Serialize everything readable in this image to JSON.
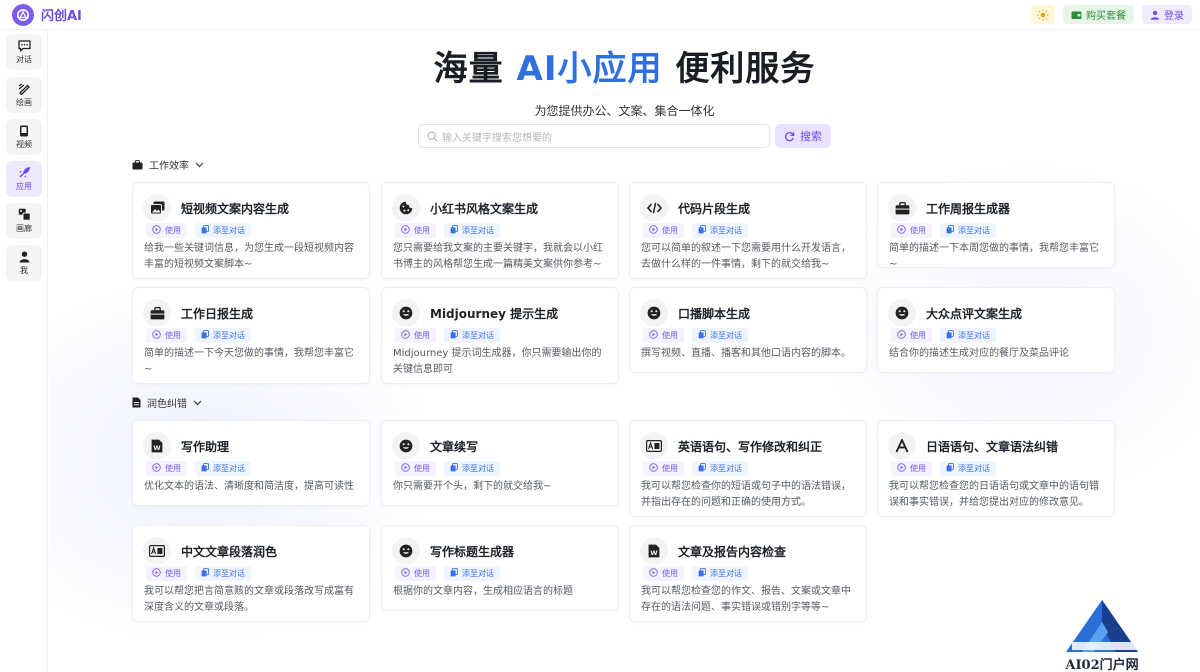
{
  "app": {
    "name": "闪创AI"
  },
  "topbar": {
    "buy_label": "购买套餐",
    "login_label": "登录"
  },
  "sidebar": {
    "items": [
      {
        "label": "对话",
        "icon": "chat-icon"
      },
      {
        "label": "绘画",
        "icon": "brush-icon"
      },
      {
        "label": "视频",
        "icon": "video-icon"
      },
      {
        "label": "应用",
        "icon": "rocket-icon",
        "active": true
      },
      {
        "label": "画廊",
        "icon": "gallery-icon"
      },
      {
        "label": "我",
        "icon": "user-icon"
      }
    ]
  },
  "hero": {
    "prefix": "海量 ",
    "highlight": "AI小应用",
    "suffix": " 便利服务",
    "subtitle": "为您提供办公、文案、集合一体化"
  },
  "search": {
    "placeholder": "输入关键字搜索您想要的",
    "button_label": "搜索"
  },
  "common": {
    "use_label": "使用",
    "add_label": "添至对话"
  },
  "sections": [
    {
      "title": "工作效率",
      "icon": "briefcase-icon",
      "cards": [
        {
          "title": "短视频文案内容生成",
          "icon": "photo-stack-icon",
          "desc": "给我一些关键词信息，为您生成一段短视频内容丰富的短视频文案脚本~"
        },
        {
          "title": "小红书风格文案生成",
          "icon": "cookie-icon",
          "desc": "您只需要给我文案的主要关键字，我就会以小红书博主的风格帮您生成一篇精美文案供你参考~"
        },
        {
          "title": "代码片段生成",
          "icon": "code-icon",
          "desc": "您可以简单的叙述一下您需要用什么开发语言，去做什么样的一件事情，剩下的就交给我~"
        },
        {
          "title": "工作周报生成器",
          "icon": "briefcase-icon",
          "desc": "简单的描述一下本周您做的事情，我帮您丰富它~"
        },
        {
          "title": "工作日报生成",
          "icon": "briefcase-icon",
          "desc": "简单的描述一下今天您做的事情，我帮您丰富它~"
        },
        {
          "title": "Midjourney 提示生成",
          "icon": "smile-icon",
          "desc": "Midjourney 提示词生成器，你只需要输出你的关键信息即可"
        },
        {
          "title": "口播脚本生成",
          "icon": "smile-icon",
          "desc": "撰写视频、直播、播客和其他口语内容的脚本。"
        },
        {
          "title": "大众点评文案生成",
          "icon": "smile-icon",
          "desc": "结合你的描述生成对应的餐厅及菜品评论"
        }
      ]
    },
    {
      "title": "润色纠错",
      "icon": "document-icon",
      "cards": [
        {
          "title": "写作助理",
          "icon": "word-file-icon",
          "desc": "优化文本的语法、清晰度和简洁度，提高可读性"
        },
        {
          "title": "文章续写",
          "icon": "smile-icon",
          "desc": "你只需要开个头，剩下的就交给我~"
        },
        {
          "title": "英语语句、写作修改和纠正",
          "icon": "translate-icon",
          "desc": "我可以帮您检查你的短语或句子中的语法错误，并指出存在的问题和正确的使用方式。"
        },
        {
          "title": "日语语句、文章语法纠错",
          "icon": "letter-a-icon",
          "desc": "我可以帮您检查您的日语语句或文章中的语句错误和事实错误，并给您提出对应的修改意见。"
        },
        {
          "title": "中文文章段落润色",
          "icon": "translate-icon",
          "desc": "我可以帮您把言简意赅的文章或段落改写成富有深度含义的文章或段落。"
        },
        {
          "title": "写作标题生成器",
          "icon": "smile-icon",
          "desc": "根据你的文章内容，生成相应语言的标题"
        },
        {
          "title": "文章及报告内容检查",
          "icon": "word-file-icon",
          "desc": "我可以帮您检查您的作文、报告、文案或文章中存在的语法问题、事实错误或错别字等等~"
        }
      ]
    }
  ],
  "watermark": {
    "text": "AI02门户网"
  },
  "colors": {
    "accent": "#6c4be6",
    "highlight": "#2f6fe0",
    "add_tag": "#3b72e8"
  }
}
